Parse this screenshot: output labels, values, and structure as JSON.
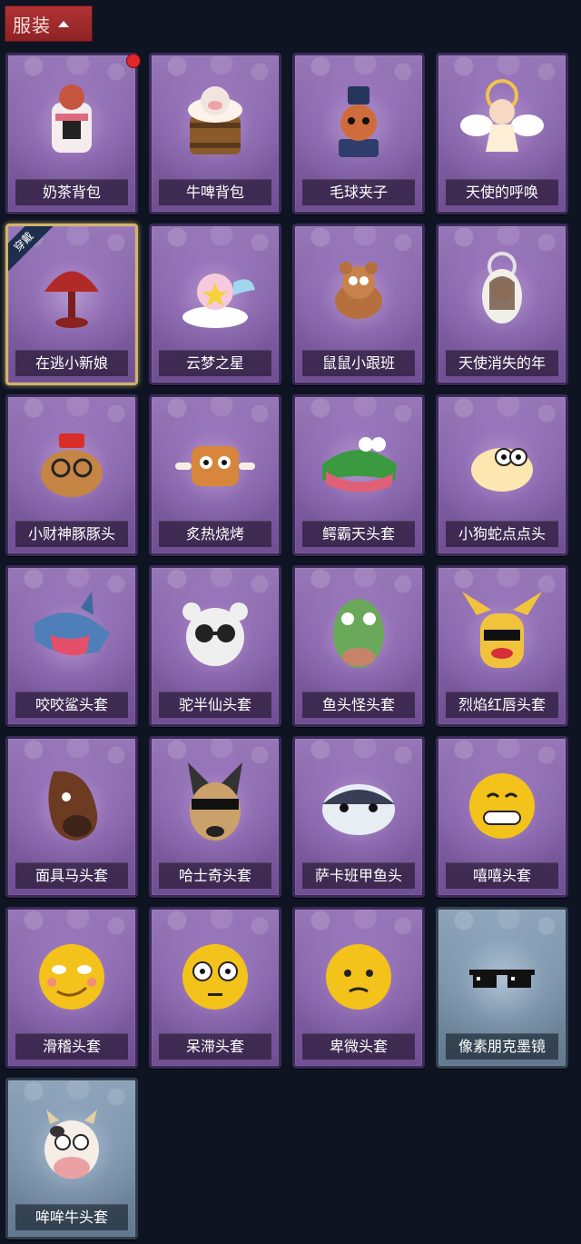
{
  "header": {
    "tab_label": "服装"
  },
  "equipped_badge": "穿戴",
  "items": [
    {
      "label": "奶茶背包",
      "icon": "milk-tea-backpack-icon",
      "frame": "purple"
    },
    {
      "label": "牛啤背包",
      "icon": "cow-beer-backpack-icon",
      "frame": "purple"
    },
    {
      "label": "毛球夹子",
      "icon": "fluff-ball-clip-icon",
      "frame": "purple"
    },
    {
      "label": "天使的呼唤",
      "icon": "angel-call-icon",
      "frame": "purple"
    },
    {
      "label": "在逃小新娘",
      "icon": "runaway-bride-icon",
      "frame": "purple",
      "equipped": true
    },
    {
      "label": "云梦之星",
      "icon": "cloud-dream-star-icon",
      "frame": "purple"
    },
    {
      "label": "鼠鼠小跟班",
      "icon": "mouse-sidekick-icon",
      "frame": "purple"
    },
    {
      "label": "天使消失的年",
      "icon": "angel-vanished-year-icon",
      "frame": "purple"
    },
    {
      "label": "小财神豚豚头",
      "icon": "capybara-fortune-head-icon",
      "frame": "purple"
    },
    {
      "label": "炙热烧烤",
      "icon": "hot-bbq-icon",
      "frame": "purple"
    },
    {
      "label": "鳄霸天头套",
      "icon": "crocodile-head-icon",
      "frame": "purple"
    },
    {
      "label": "小狗蛇点点头",
      "icon": "dog-snake-head-icon",
      "frame": "purple"
    },
    {
      "label": "咬咬鲨头套",
      "icon": "shark-head-icon",
      "frame": "purple"
    },
    {
      "label": "驼半仙头套",
      "icon": "bear-glasses-head-icon",
      "frame": "purple"
    },
    {
      "label": "鱼头怪头套",
      "icon": "fish-monster-head-icon",
      "frame": "purple"
    },
    {
      "label": "烈焰红唇头套",
      "icon": "red-lips-head-icon",
      "frame": "purple"
    },
    {
      "label": "面具马头套",
      "icon": "horse-mask-head-icon",
      "frame": "purple"
    },
    {
      "label": "哈士奇头套",
      "icon": "husky-head-icon",
      "frame": "purple"
    },
    {
      "label": "萨卡班甲鱼头",
      "icon": "sacabambaspis-head-icon",
      "frame": "purple"
    },
    {
      "label": "嘻嘻头套",
      "icon": "grin-emoji-head-icon",
      "frame": "purple"
    },
    {
      "label": "滑稽头套",
      "icon": "funny-emoji-head-icon",
      "frame": "purple"
    },
    {
      "label": "呆滞头套",
      "icon": "dazed-emoji-head-icon",
      "frame": "purple"
    },
    {
      "label": "卑微头套",
      "icon": "humble-emoji-head-icon",
      "frame": "purple"
    },
    {
      "label": "像素朋克墨镜",
      "icon": "pixel-sunglasses-icon",
      "frame": "blue"
    },
    {
      "label": "哞哞牛头套",
      "icon": "cow-head-icon",
      "frame": "blue"
    }
  ],
  "colors": {
    "background": "#0f1423",
    "tab": "#a22a2b",
    "card_purple": "#8a69ad",
    "card_blue": "#7a90a8",
    "equipped_border": "#d0b46b",
    "notification_dot": "#e0282c"
  }
}
